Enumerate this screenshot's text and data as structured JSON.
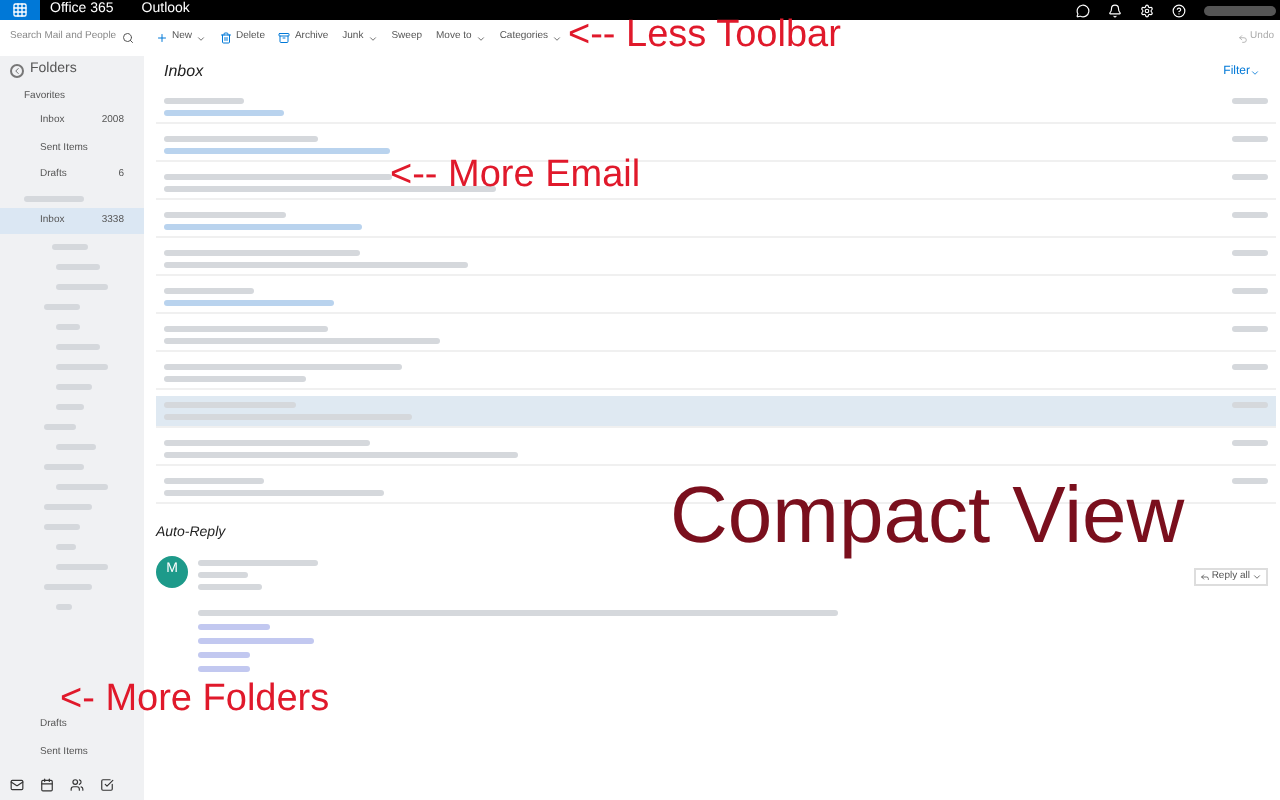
{
  "top_bar": {
    "suite": "Office 365",
    "app": "Outlook"
  },
  "toolbar": {
    "search": {
      "placeholder": "Search Mail and People"
    },
    "actions": [
      {
        "label": "New",
        "menu": true
      },
      {
        "label": "Delete",
        "menu": false
      },
      {
        "label": "Archive",
        "menu": false
      },
      {
        "label": "Junk",
        "menu": true
      },
      {
        "label": "Sweep",
        "menu": false
      },
      {
        "label": "Move to",
        "menu": true
      },
      {
        "label": "Categories",
        "menu": true
      }
    ],
    "undo": "Undo"
  },
  "sidebar": {
    "header": "Folders",
    "favorites": "Favorites",
    "favorite_items": [
      {
        "label": "Inbox",
        "count": "2008"
      },
      {
        "label": "Sent Items"
      },
      {
        "label": "Drafts",
        "count": "6"
      }
    ],
    "main_inbox": {
      "label": "Inbox",
      "count": "3338",
      "selected": true
    },
    "bottom_items": [
      {
        "label": "Drafts"
      },
      {
        "label": "Sent Items"
      }
    ]
  },
  "list": {
    "title": "Inbox",
    "filter": "Filter",
    "messages": [
      {
        "selected": false,
        "link": true
      },
      {
        "selected": false,
        "link": true
      },
      {
        "selected": false,
        "link": false
      },
      {
        "selected": false,
        "link": true
      },
      {
        "selected": false,
        "link": false
      },
      {
        "selected": false,
        "link": true
      },
      {
        "selected": false,
        "link": false
      },
      {
        "selected": false,
        "link": false
      },
      {
        "selected": true,
        "link": false
      },
      {
        "selected": false,
        "link": false
      },
      {
        "selected": false,
        "link": false
      }
    ]
  },
  "reading": {
    "subject": "Auto-Reply",
    "avatar": "M",
    "reply_all": "Reply all"
  },
  "annotations": [
    {
      "text": "<-- Less Toolbar",
      "kind": "small"
    },
    {
      "text": "<--  More Email",
      "kind": "small"
    },
    {
      "text": "Compact View",
      "kind": "big"
    },
    {
      "text": "<- More Folders",
      "kind": "small"
    }
  ]
}
